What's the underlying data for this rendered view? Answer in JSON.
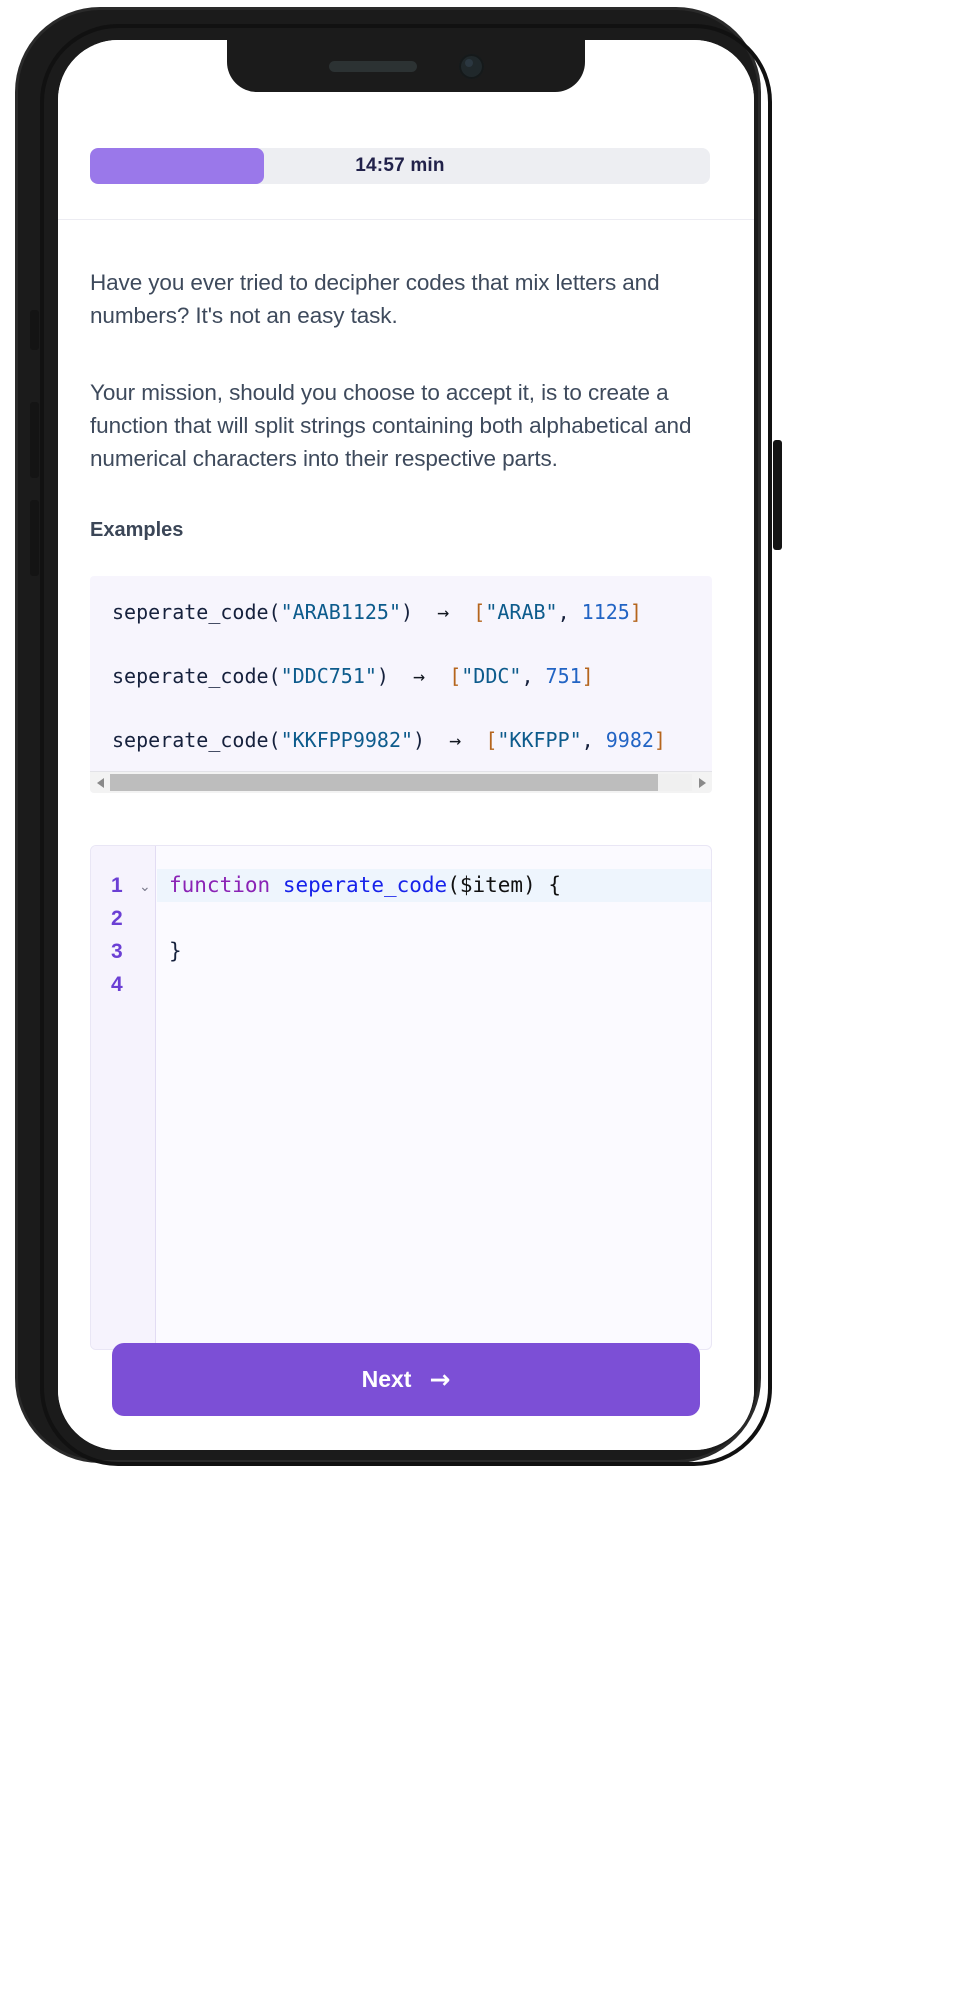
{
  "progress": {
    "time_label": "14:57 min",
    "fill_percent": 28,
    "fill_color": "#9a78ea",
    "track_color": "#edeef2"
  },
  "content": {
    "paragraph_1": "Have you ever tried to decipher codes that mix letters and numbers? It's not an easy task.",
    "paragraph_2": "Your mission, should you choose to accept it, is to create a function that will split strings containing both alphabetical and numerical characters into their respective parts.",
    "examples_heading": "Examples"
  },
  "examples": {
    "lines": [
      {
        "call": "seperate_code(",
        "arg": "\"ARAB1125\"",
        "close": ")",
        "arrow": "→",
        "open_bracket": "[",
        "result_str": "\"ARAB\"",
        "comma": ", ",
        "result_num": "1125",
        "close_bracket": "]"
      },
      {
        "call": "seperate_code(",
        "arg": "\"DDC751\"",
        "close": ")",
        "arrow": "→",
        "open_bracket": "[",
        "result_str": "\"DDC\"",
        "comma": ", ",
        "result_num": "751",
        "close_bracket": "]"
      },
      {
        "call": "seperate_code(",
        "arg": "\"KKFPP9982\"",
        "close": ")",
        "arrow": "→",
        "open_bracket": "[",
        "result_str": "\"KKFPP\"",
        "comma": ", ",
        "result_num": "9982",
        "close_bracket": "]"
      }
    ]
  },
  "editor": {
    "line_numbers": [
      "1",
      "2",
      "3",
      "4"
    ],
    "fold_icon": "⌄",
    "line_1": {
      "keyword": "function",
      "space": " ",
      "fn_name": "seperate_code",
      "paren_open": "(",
      "param": "$item",
      "paren_close": ")",
      "brace": " {"
    },
    "line_2": "",
    "line_3": "}",
    "line_4": ""
  },
  "footer": {
    "next_label": "Next",
    "next_icon": "→",
    "next_color": "#7c4fd6"
  },
  "device": {
    "notch_speaker": "speaker-bar",
    "notch_camera": "front-camera"
  }
}
